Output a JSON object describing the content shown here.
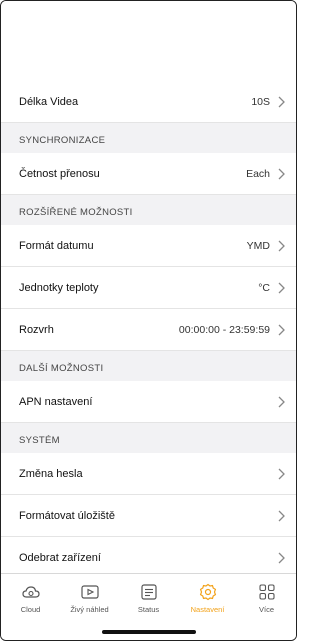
{
  "rows": {
    "video_length": {
      "label": "Délka Videa",
      "value": "10S"
    },
    "sync_header": "SYNCHRONIZACE",
    "transfer_frequency": {
      "label": "Četnost přenosu",
      "value": "Each"
    },
    "advanced_header": "ROZŠÍŘENÉ MOŽNOSTI",
    "date_format": {
      "label": "Formát datumu",
      "value": "YMD"
    },
    "temp_units": {
      "label": "Jednotky teploty",
      "value": "°C"
    },
    "schedule": {
      "label": "Rozvrh",
      "value": "00:00:00 - 23:59:59"
    },
    "more_header": "DALŠÍ MOŽNOSTI",
    "apn": {
      "label": "APN nastavení"
    },
    "system_header": "SYSTÉM",
    "change_password": {
      "label": "Změna hesla"
    },
    "format_storage": {
      "label": "Formátovat úložiště"
    },
    "remove_device": {
      "label": "Odebrat zařízení"
    }
  },
  "tabbar": {
    "items": [
      {
        "label": "Cloud",
        "icon": "cloud-icon"
      },
      {
        "label": "Živý náhled",
        "icon": "live-view-icon"
      },
      {
        "label": "Status",
        "icon": "status-icon"
      },
      {
        "label": "Nastavení",
        "icon": "settings-icon"
      },
      {
        "label": "Více",
        "icon": "more-grid-icon"
      }
    ],
    "active_color": "#f2a21a"
  }
}
